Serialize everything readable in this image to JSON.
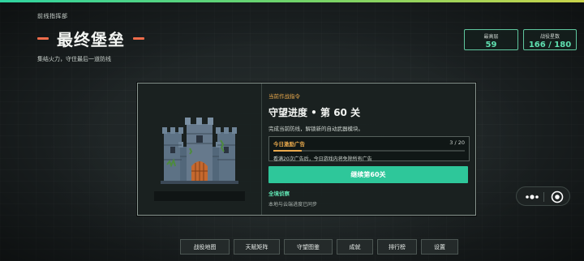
{
  "header": {
    "kicker": "前线指挥部",
    "title": "最终堡垒",
    "subtitle": "集结火力，守住最后一道防线"
  },
  "stats": [
    {
      "label": "最高层",
      "value": "59"
    },
    {
      "label": "战役星数",
      "value": "166 / 180"
    }
  ],
  "mission": {
    "kicker": "当前作战指令",
    "title": "守望进度 • 第 60 关",
    "description": "完成当前防线，解锁新的自动武器模块。",
    "ad_progress": {
      "label": "今日激励广告",
      "count": "3 / 20",
      "fraction": 0.15,
      "note": "看满20次广告后，今日游戏内将免除所有广告"
    },
    "cta_label": "继续第60关",
    "sync_title": "全境侦察",
    "sync_note": "本地与云端进度已同步"
  },
  "nav": [
    {
      "label": "战役地图"
    },
    {
      "label": "天赋矩阵"
    },
    {
      "label": "守望图鉴"
    },
    {
      "label": "成就"
    },
    {
      "label": "排行榜"
    },
    {
      "label": "设置"
    }
  ],
  "colors": {
    "accent_green": "#2ec79a",
    "accent_orange": "#e9a94c",
    "title_dash": "#ef6c4b"
  }
}
